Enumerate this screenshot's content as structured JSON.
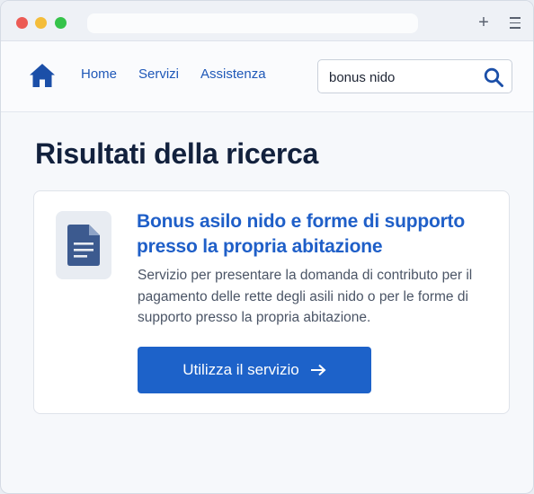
{
  "browser": {
    "new_tab_icon": "plus-icon",
    "menu_icon": "hamburger-icon"
  },
  "nav": {
    "home_icon": "home-icon",
    "links": [
      "Home",
      "Servizi",
      "Assistenza"
    ],
    "search": {
      "value": "bonus nido",
      "placeholder": "",
      "icon": "search-icon"
    }
  },
  "main": {
    "title": "Risultati della ricerca",
    "result": {
      "icon": "document-icon",
      "title": "Bonus asilo nido e forme di supporto presso la propria abitazione",
      "description": "Servizio per presentare la domanda di contributo per il pagamento delle rette degli asili nido o per le forme di supporto presso la propria abitazione.",
      "button_label": "Utilizza il servizio",
      "button_icon": "arrow-right-icon"
    }
  },
  "colors": {
    "accent": "#1d62c9",
    "link": "#1f58b8",
    "title": "#12213d"
  }
}
